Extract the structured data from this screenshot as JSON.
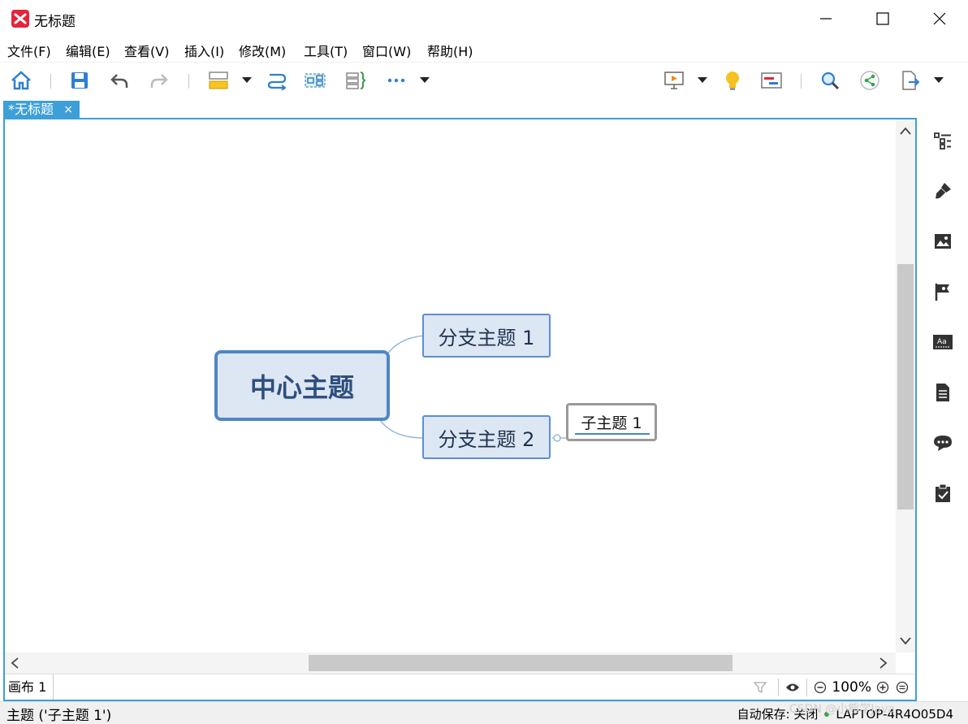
{
  "window": {
    "title": "无标题"
  },
  "menu": [
    "文件(F)",
    "编辑(E)",
    "查看(V)",
    "插入(I)",
    "修改(M)",
    "工具(T)",
    "窗口(W)",
    "帮助(H)"
  ],
  "toolbar": {
    "icons": [
      "home-icon",
      "save-icon",
      "undo-icon",
      "redo-icon",
      "topic-icon",
      "relationship-icon",
      "boundary-icon",
      "summary-icon",
      "more-icon",
      "presentation-icon",
      "brainstorm-icon",
      "gantt-icon",
      "search-icon",
      "share-icon",
      "export-icon"
    ]
  },
  "tab": {
    "label": "*无标题",
    "close": "×"
  },
  "mindmap": {
    "central": "中心主题",
    "branches": [
      "分支主题 1",
      "分支主题 2"
    ],
    "subtopic": "子主题 1"
  },
  "sheetbar": {
    "sheet": "画布 1",
    "zoom": "100%"
  },
  "rightpanel": {
    "icons": [
      "outline-icon",
      "format-brush-icon",
      "image-icon",
      "marker-flag-icon",
      "text-style-icon",
      "notes-icon",
      "comments-icon",
      "task-icon"
    ]
  },
  "status": {
    "selection": "主题 ('子主题 1')",
    "autosave": "自动保存: 关闭",
    "computer": "LAPTOP-4R4O05D4",
    "watermark": "CSDN @小熊学Java"
  },
  "colors": {
    "accent": "#3d9fd8",
    "node_fill": "#dde6f3",
    "node_border": "#4f86c6",
    "logo": "#e3263b"
  }
}
